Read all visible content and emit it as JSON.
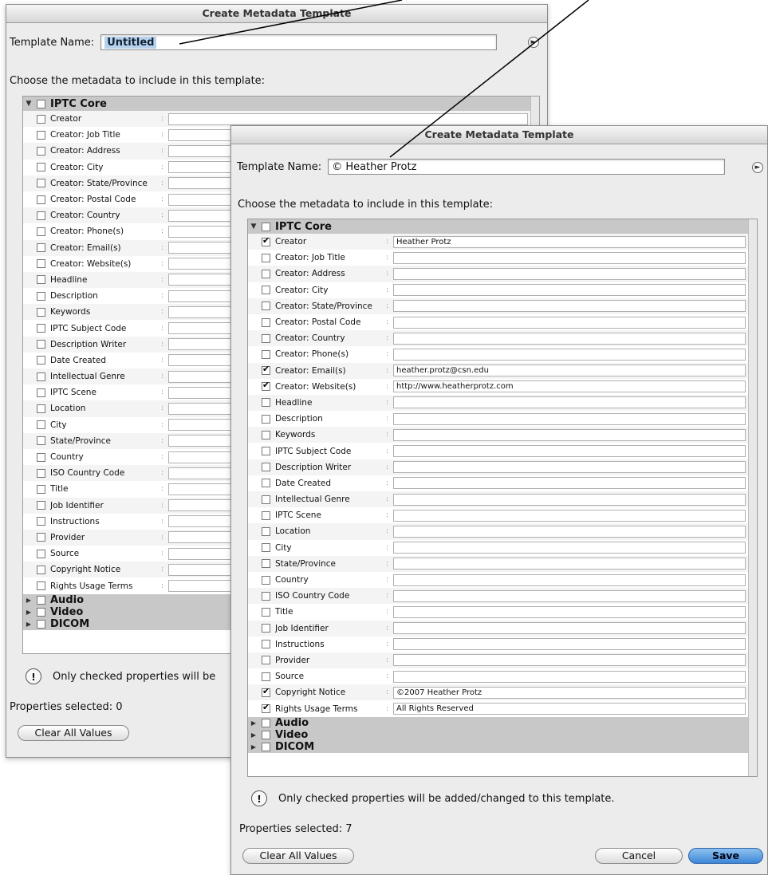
{
  "back_dialog": {
    "title": "Create Metadata Template",
    "template_name_label": "Template Name:",
    "template_name_value": "Untitled",
    "choose_label": "Choose the metadata to include in this template:",
    "group_core": "IPTC Core",
    "rows": [
      "Creator",
      "Creator: Job Title",
      "Creator: Address",
      "Creator: City",
      "Creator: State/Province",
      "Creator: Postal Code",
      "Creator: Country",
      "Creator: Phone(s)",
      "Creator: Email(s)",
      "Creator: Website(s)",
      "Headline",
      "Description",
      "Keywords",
      "IPTC Subject Code",
      "Description Writer",
      "Date Created",
      "Intellectual Genre",
      "IPTC Scene",
      "Location",
      "City",
      "State/Province",
      "Country",
      "ISO Country Code",
      "Title",
      "Job Identifier",
      "Instructions",
      "Provider",
      "Source",
      "Copyright Notice",
      "Rights Usage Terms"
    ],
    "other_groups": [
      "Audio",
      "Video",
      "DICOM"
    ],
    "note": "Only checked properties will be",
    "props_label": "Properties selected:",
    "props_count": "0",
    "clear_button": "Clear All Values"
  },
  "front_dialog": {
    "title": "Create Metadata Template",
    "template_name_label": "Template Name:",
    "template_name_value": "© Heather Protz",
    "choose_label": "Choose the metadata to include in this template:",
    "group_core": "IPTC Core",
    "rows": [
      {
        "label": "Creator",
        "checked": true,
        "value": "Heather Protz"
      },
      {
        "label": "Creator: Job Title",
        "checked": false,
        "value": ""
      },
      {
        "label": "Creator: Address",
        "checked": false,
        "value": ""
      },
      {
        "label": "Creator: City",
        "checked": false,
        "value": ""
      },
      {
        "label": "Creator: State/Province",
        "checked": false,
        "value": ""
      },
      {
        "label": "Creator: Postal Code",
        "checked": false,
        "value": ""
      },
      {
        "label": "Creator: Country",
        "checked": false,
        "value": ""
      },
      {
        "label": "Creator: Phone(s)",
        "checked": false,
        "value": ""
      },
      {
        "label": "Creator: Email(s)",
        "checked": true,
        "value": "heather.protz@csn.edu"
      },
      {
        "label": "Creator: Website(s)",
        "checked": true,
        "value": "http://www.heatherprotz.com"
      },
      {
        "label": "Headline",
        "checked": false,
        "value": ""
      },
      {
        "label": "Description",
        "checked": false,
        "value": ""
      },
      {
        "label": "Keywords",
        "checked": false,
        "value": ""
      },
      {
        "label": "IPTC Subject Code",
        "checked": false,
        "value": ""
      },
      {
        "label": "Description Writer",
        "checked": false,
        "value": ""
      },
      {
        "label": "Date Created",
        "checked": false,
        "value": ""
      },
      {
        "label": "Intellectual Genre",
        "checked": false,
        "value": ""
      },
      {
        "label": "IPTC Scene",
        "checked": false,
        "value": ""
      },
      {
        "label": "Location",
        "checked": false,
        "value": ""
      },
      {
        "label": "City",
        "checked": false,
        "value": ""
      },
      {
        "label": "State/Province",
        "checked": false,
        "value": ""
      },
      {
        "label": "Country",
        "checked": false,
        "value": ""
      },
      {
        "label": "ISO Country Code",
        "checked": false,
        "value": ""
      },
      {
        "label": "Title",
        "checked": false,
        "value": ""
      },
      {
        "label": "Job Identifier",
        "checked": false,
        "value": ""
      },
      {
        "label": "Instructions",
        "checked": false,
        "value": ""
      },
      {
        "label": "Provider",
        "checked": false,
        "value": ""
      },
      {
        "label": "Source",
        "checked": false,
        "value": ""
      },
      {
        "label": "Copyright Notice",
        "checked": true,
        "value": "©2007 Heather Protz"
      },
      {
        "label": "Rights Usage Terms",
        "checked": true,
        "value": "All Rights Reserved"
      }
    ],
    "other_groups": [
      "Audio",
      "Video",
      "DICOM"
    ],
    "note": "Only checked properties will be added/changed to this template.",
    "props_label": "Properties selected:",
    "props_count": "7",
    "clear_button": "Clear All Values",
    "cancel_button": "Cancel",
    "save_button": "Save"
  },
  "icons": {
    "note": "exclamation-icon",
    "help": "options-icon",
    "expand": "disclosure-triangle-icon"
  },
  "colors": {
    "dialog_bg": "#ececec",
    "group_bg": "#c8c8c8",
    "save_accent": "#3d86d6",
    "selection": "#b6d1ee"
  }
}
